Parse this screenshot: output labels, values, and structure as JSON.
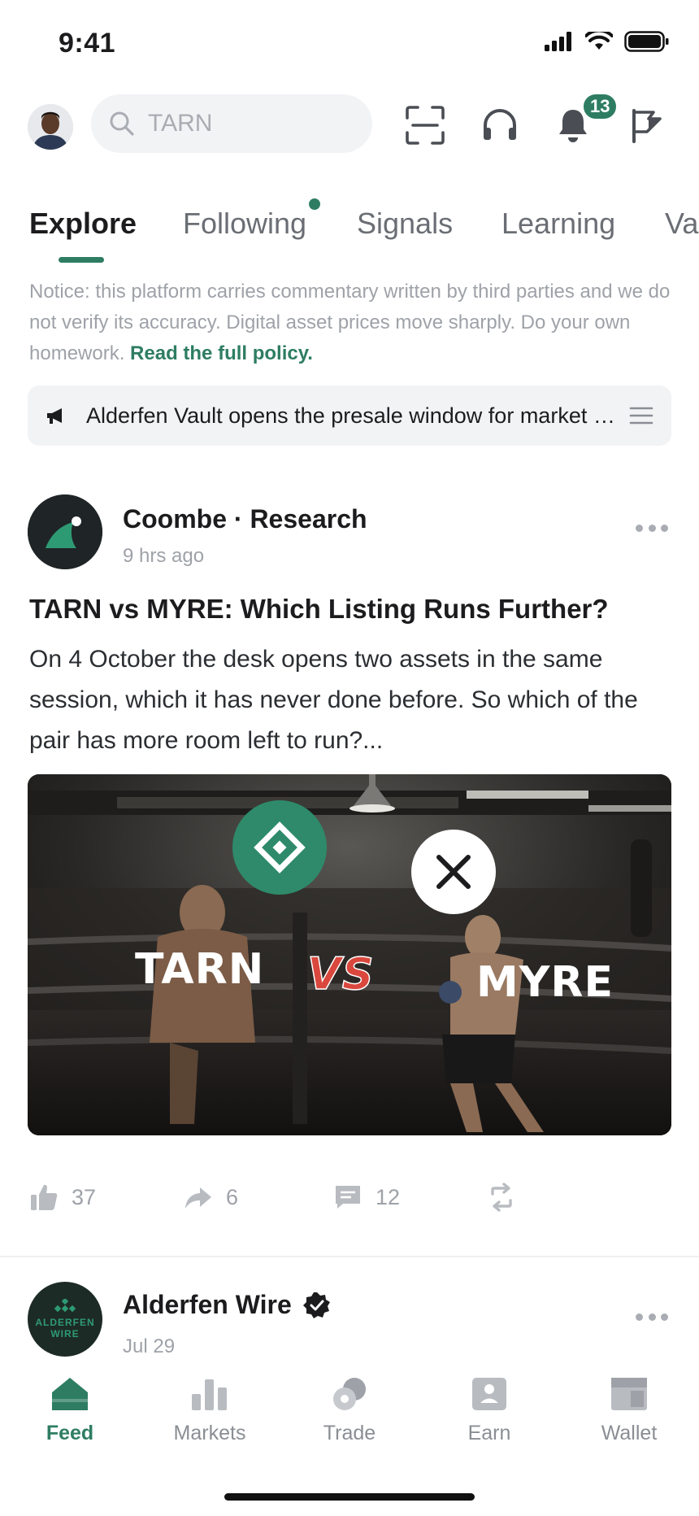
{
  "status_bar": {
    "time": "9:41"
  },
  "top_bar": {
    "search_placeholder": "TARN",
    "notification_count": "13"
  },
  "tabs": [
    {
      "label": "Explore",
      "active": true
    },
    {
      "label": "Following",
      "has_dot": true
    },
    {
      "label": "Signals"
    },
    {
      "label": "Learning"
    },
    {
      "label": "Va"
    }
  ],
  "notice": {
    "text": "Notice: this platform carries commentary written by third parties and we do not verify its accuracy. Digital asset prices move sharply. Do your own homework.",
    "link": "Read the full policy."
  },
  "announcement": {
    "text": "Alderfen Vault opens the presale window for market makers"
  },
  "post": {
    "author": "Coombe · Research",
    "time": "9 hrs ago",
    "title": "TARN vs MYRE: Which Listing Runs Further?",
    "body": "On 4 October the desk opens two assets in the same session, which it has never done before. So which of the pair has more room left to run?...",
    "image": {
      "left_label": "TARN",
      "vs_label": "VS",
      "right_label": "MYRE"
    },
    "actions": {
      "likes": "37",
      "shares": "6",
      "comments": "12"
    }
  },
  "post2": {
    "author": "Alderfen Wire",
    "avatar_text_line1": "ALDERFEN",
    "avatar_text_line2": "WIRE",
    "time": "Jul 29"
  },
  "bottom_nav": [
    {
      "label": "Feed",
      "active": true
    },
    {
      "label": "Markets"
    },
    {
      "label": "Trade"
    },
    {
      "label": "Earn"
    },
    {
      "label": "Wallet"
    }
  ],
  "colors": {
    "accent": "#2e7d63",
    "vs_red": "#d9473d"
  }
}
